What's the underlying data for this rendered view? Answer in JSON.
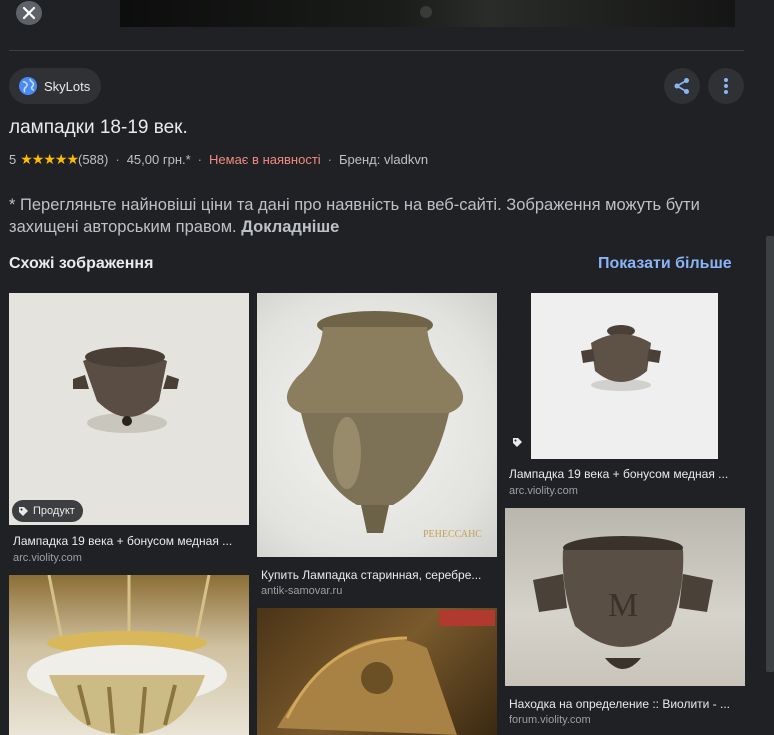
{
  "header": {
    "close_icon": "close-icon",
    "source_name": "SkyLots",
    "source_icon": "globe-icon",
    "share_icon": "share-icon",
    "more_icon": "more-vert-icon"
  },
  "product": {
    "title": "лампадки 18-19 век.",
    "rating": "5",
    "stars": "★★★★★",
    "reviews": "(588)",
    "price": "45,00 грн.*",
    "availability": "Немає в наявності",
    "brand": "Бренд: vladkvn",
    "separator": "·"
  },
  "disclaimer": {
    "text": "* Перегляньте найновіші ціни та дані про наявність на веб-сайті. Зображення можуть бути захищені авторським правом.",
    "link": "Докладніше"
  },
  "similar": {
    "heading": "Схожі зображення",
    "show_more": "Показати більше",
    "items": [
      {
        "title": "Лампадка 19 века + бонусом медная ...",
        "source": "arc.violity.com",
        "badge": "Продукт"
      },
      {
        "title": "Купить Лампадка старинная, серебре...",
        "source": "antik-samovar.ru"
      },
      {
        "title": "Лампадка 19 века + бонусом медная ...",
        "source": "arc.violity.com"
      },
      {
        "title": "Находка на определение :: Виолити - ...",
        "source": "forum.violity.com"
      }
    ],
    "watermark": "РЕНЕССАНС"
  },
  "colors": {
    "background": "#202124",
    "link_blue": "#8ab4f8",
    "out_of_stock": "#f28b82",
    "star": "#fbbc04"
  }
}
